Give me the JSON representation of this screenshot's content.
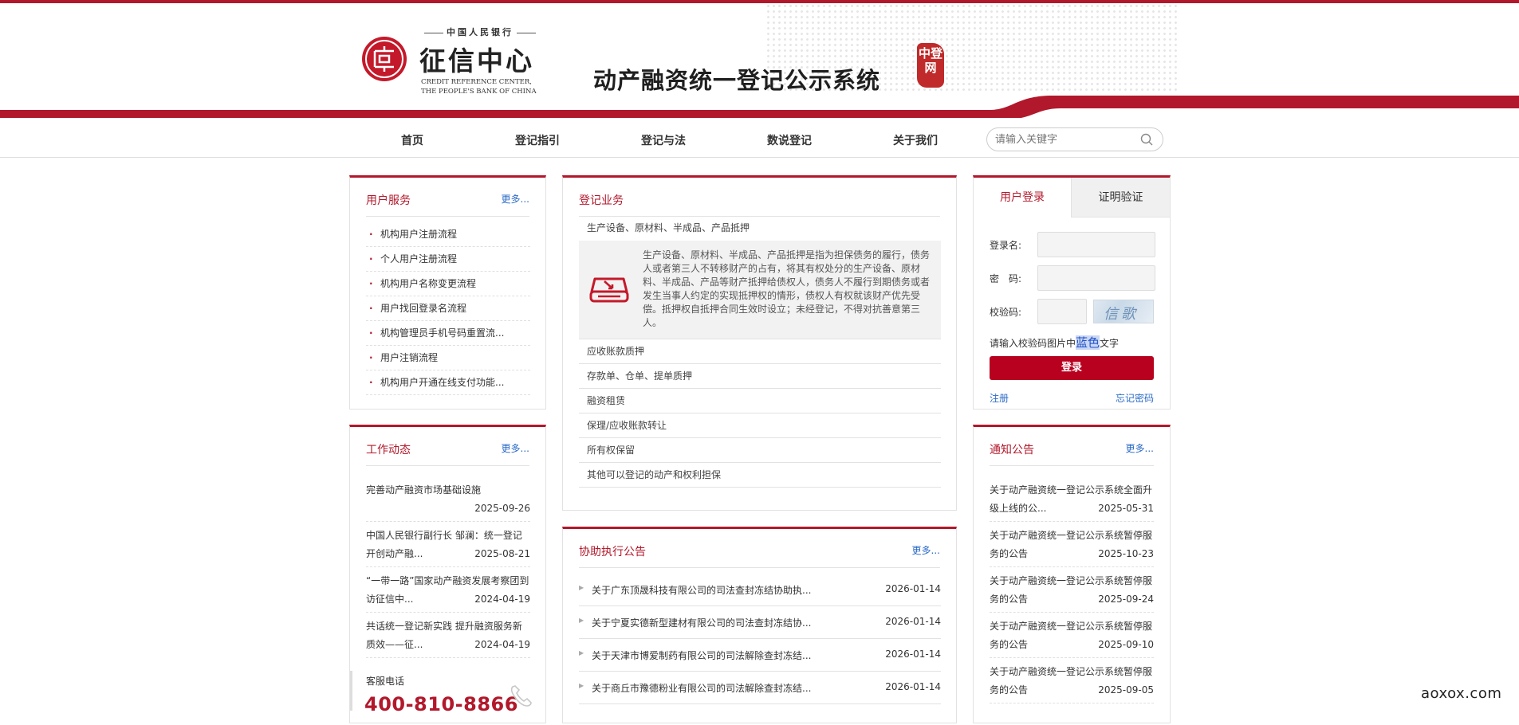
{
  "header": {
    "org_small": "中国人民银行",
    "org_big": "征信中心",
    "org_en_line1": "CREDIT REFERENCE CENTER,",
    "org_en_line2": "THE PEOPLE'S BANK OF CHINA",
    "system_title": "动产融资统一登记公示系统",
    "seal_text": "中登网"
  },
  "nav": {
    "items": [
      "首页",
      "登记指引",
      "登记与法",
      "数说登记",
      "关于我们"
    ],
    "search_placeholder": "请输入关键字"
  },
  "user_service": {
    "title": "用户服务",
    "more": "更多...",
    "items": [
      "机构用户注册流程",
      "个人用户注册流程",
      "机构用户名称变更流程",
      "用户找回登录名流程",
      "机构管理员手机号码重置流...",
      "用户注销流程",
      "机构用户开通在线支付功能..."
    ]
  },
  "work_news": {
    "title": "工作动态",
    "more": "更多...",
    "items": [
      {
        "title": "完善动产融资市场基础设施",
        "date": "2025-09-26"
      },
      {
        "title": "中国人民银行副行长 邹澜：统一登记开创动产融...",
        "date": "2025-08-21"
      },
      {
        "title": "“一带一路”国家动产融资发展考察团到访征信中...",
        "date": "2024-04-19"
      },
      {
        "title": "共话统一登记新实践 提升融资服务新质效——征...",
        "date": "2024-04-19"
      }
    ],
    "hotline_label": "客服电话",
    "hotline": "400-810-8866"
  },
  "registration": {
    "title": "登记业务",
    "first": "生产设备、原材料、半成品、产品抵押",
    "detail": "生产设备、原材料、半成品、产品抵押是指为担保债务的履行，债务人或者第三人不转移财产的占有，将其有权处分的生产设备、原材料、半成品、产品等财产抵押给债权人，债务人不履行到期债务或者发生当事人约定的实现抵押权的情形，债权人有权就该财产优先受偿。抵押权自抵押合同生效时设立；未经登记，不得对抗善意第三人。",
    "items": [
      "应收账款质押",
      "存款单、仓单、提单质押",
      "融资租赁",
      "保理/应收账款转让",
      "所有权保留",
      "其他可以登记的动产和权利担保"
    ]
  },
  "assist": {
    "title": "协助执行公告",
    "more": "更多...",
    "items": [
      {
        "title": "关于广东顶晟科技有限公司的司法查封冻结协助执...",
        "date": "2026-01-14"
      },
      {
        "title": "关于宁夏实德新型建材有限公司的司法查封冻结协...",
        "date": "2026-01-14"
      },
      {
        "title": "关于天津市博爱制药有限公司的司法解除查封冻结...",
        "date": "2026-01-14"
      },
      {
        "title": "关于商丘市豫德粉业有限公司的司法解除查封冻结...",
        "date": "2026-01-14"
      }
    ]
  },
  "login": {
    "tab_login": "用户登录",
    "tab_verify": "证明验证",
    "username_label": "登录名:",
    "password_label": "密　码:",
    "captcha_label": "校验码:",
    "captcha_text": "信歌石",
    "hint_pre": "请输入校验码图片中",
    "hint_hl": "蓝色",
    "hint_post": "文字",
    "button": "登录",
    "register": "注册",
    "forgot": "忘记密码"
  },
  "notices": {
    "title": "通知公告",
    "more": "更多...",
    "items": [
      {
        "title": "关于动产融资统一登记公示系统全面升级上线的公...",
        "date": "2025-05-31"
      },
      {
        "title": "关于动产融资统一登记公示系统暂停服务的公告",
        "date": "2025-10-23"
      },
      {
        "title": "关于动产融资统一登记公示系统暂停服务的公告",
        "date": "2025-09-24"
      },
      {
        "title": "关于动产融资统一登记公示系统暂停服务的公告",
        "date": "2025-09-10"
      },
      {
        "title": "关于动产融资统一登记公示系统暂停服务的公告",
        "date": "2025-09-05"
      }
    ]
  },
  "watermark": "aoxox.com",
  "colors": {
    "brand_red": "#b2182b",
    "link_blue": "#2a6ac8"
  }
}
